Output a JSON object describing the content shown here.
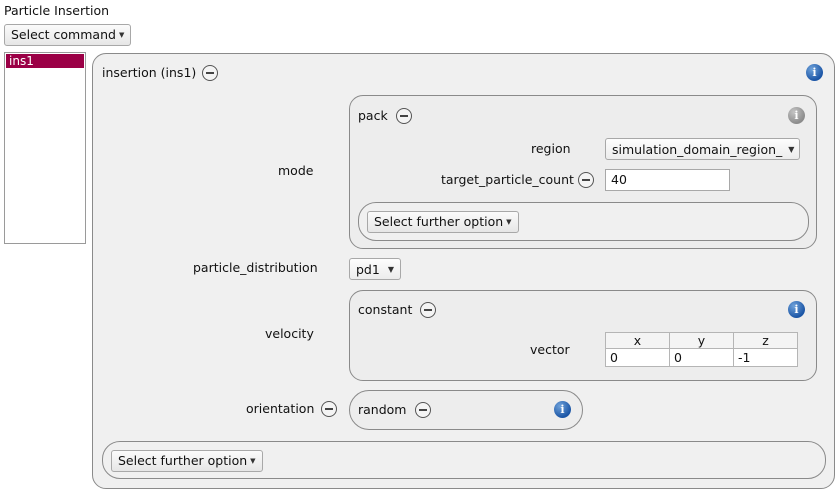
{
  "page": {
    "title": "Particle Insertion"
  },
  "toolbar": {
    "select_command": "Select command"
  },
  "list": {
    "items": [
      "ins1"
    ]
  },
  "insertion": {
    "header": "insertion (ins1)",
    "mode_label": "mode",
    "pack": {
      "header": "pack",
      "region_label": "region",
      "region_value": "simulation_domain_region_",
      "target_label": "target_particle_count",
      "target_value": "40",
      "further_option": "Select further option"
    },
    "particle_distribution_label": "particle_distribution",
    "particle_distribution_value": "pd1",
    "velocity_label": "velocity",
    "constant": {
      "header": "constant",
      "vector_label": "vector",
      "columns": [
        "x",
        "y",
        "z"
      ],
      "values": [
        "0",
        "0",
        "-1"
      ]
    },
    "orientation_label": "orientation",
    "orientation_value": "random",
    "further_option": "Select further option"
  },
  "icons": {
    "remove": "minus-circle-icon",
    "info": "info-icon",
    "dropdown": "caret-down-icon"
  },
  "colors": {
    "selection": "#9b0046",
    "info_blue": "#1c56a6",
    "info_gray": "#8c8c8c"
  }
}
